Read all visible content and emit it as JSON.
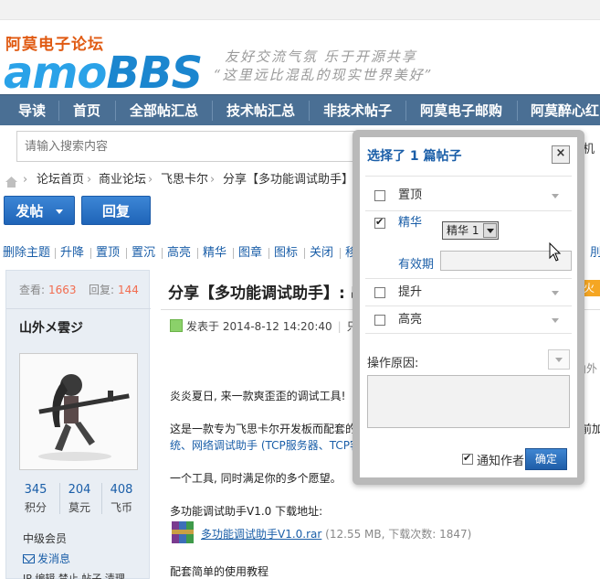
{
  "header": {
    "logo_cn": "阿莫电子论坛",
    "logo_en_a": "amo",
    "logo_en_b": "BBS",
    "slogan_line1": "友好交流气氛  乐于开源共享",
    "slogan_line2": "“这里远比混乱的现实世界美好”"
  },
  "nav": {
    "items": [
      "导读",
      "首页",
      "全部帖汇总",
      "技术帖汇总",
      "非技术帖子",
      "阿莫电子邮购",
      "阿莫醉心红"
    ]
  },
  "search": {
    "placeholder": "请输入搜索内容",
    "right_text": "机"
  },
  "breadcrumb": {
    "items": [
      "论坛首页",
      "商业论坛",
      "飞思卡尔",
      "分享【多功能调试助手】: 串"
    ]
  },
  "actions": {
    "post": "发帖",
    "reply": "回复"
  },
  "modbar": {
    "items": [
      "删除主题",
      "升降",
      "置顶",
      "置沉",
      "高亮",
      "精华",
      "图章",
      "图标",
      "关闭",
      "移"
    ],
    "tail": "刖"
  },
  "user": {
    "views_label": "查看:",
    "views": "1663",
    "replies_label": "回复:",
    "replies": "144",
    "name": "山外メ雲ジ",
    "credits": [
      {
        "num": "345",
        "label": "积分"
      },
      {
        "num": "204",
        "label": "莫元"
      },
      {
        "num": "408",
        "label": "飞币"
      }
    ],
    "level": "中级会员",
    "message": "发消息",
    "foot": "IP 编辑 禁止 帖子 清理"
  },
  "post": {
    "title": "分享【多功能调试助手】: 串",
    "meta_time": "发表于 2014-8-12 14:20:40",
    "meta_tail": "只",
    "p1": "炎炎夏日, 来一款爽歪歪的调试工具!",
    "p2": "这是一款专为飞思卡尔开发板而配套的",
    "p2_tail": "目前加",
    "p3_link": "统、网络调试助手 (TCP服务器、TCP客",
    "p4": "一个工具, 同时满足你的多个愿望。",
    "p5": "多功能调试助手V1.0 下载地址:",
    "attach_name": "多功能调试助手V1.0.rar",
    "attach_size": "(12.55 MB, 下载次数: 1847)",
    "p6": "配套简单的使用教程",
    "right_tag": "火",
    "right_gray": "山外"
  },
  "modal": {
    "title": "选择了 1 篇帖子",
    "close": "×",
    "options": [
      {
        "label": "置顶",
        "checked": false
      },
      {
        "label": "精华",
        "checked": true
      },
      {
        "label": "提升",
        "checked": false
      },
      {
        "label": "高亮",
        "checked": false
      }
    ],
    "digest_value": "精华 1",
    "expiry_label": "有效期",
    "reason_label": "操作原因:",
    "notify_label": "通知作者",
    "notify_checked": true,
    "ok": "确定"
  },
  "colors": {
    "nav_bg": "#4a6f94",
    "link": "#1a5ea8",
    "logo_orange": "#e05a12",
    "logo_blue": "#1b86cf"
  }
}
